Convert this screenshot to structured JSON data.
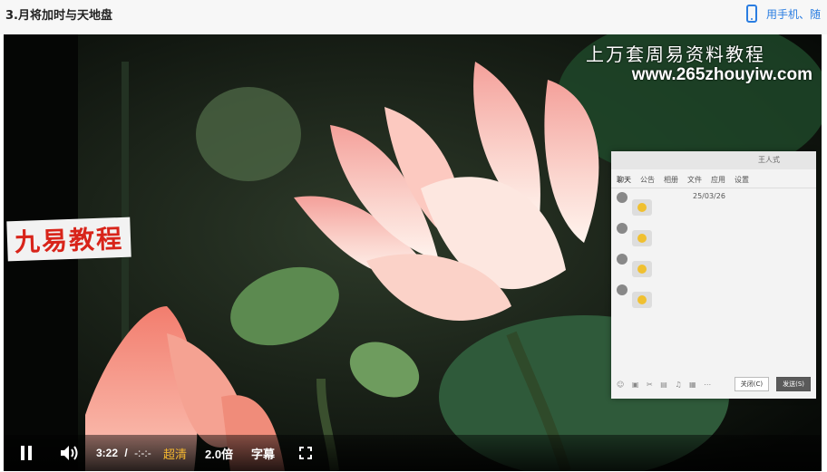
{
  "page": {
    "title": "3.月将加时与天地盘",
    "mobile_link": "用手机、随"
  },
  "video": {
    "watermark_title": "上万套周易资料教程",
    "watermark_url": "www.265zhouyiw.com",
    "brand_label": "九易教程",
    "chat_header": "王人式",
    "chat_tabs": [
      "聊天",
      "公告",
      "相册",
      "文件",
      "应用",
      "设置"
    ],
    "chat_date": "25/03/26",
    "chat_close_label": "关闭(C)",
    "chat_send_label": "发送(S)"
  },
  "controls": {
    "current_time": "3:22",
    "separator": "/",
    "duration": "-:-:-",
    "quality": "超清",
    "speed": "2.0倍",
    "subtitle": "字幕"
  },
  "colors": {
    "accent_blue": "#2a7de1",
    "quality_highlight": "#f5b830",
    "brand_red": "#d8241a"
  }
}
